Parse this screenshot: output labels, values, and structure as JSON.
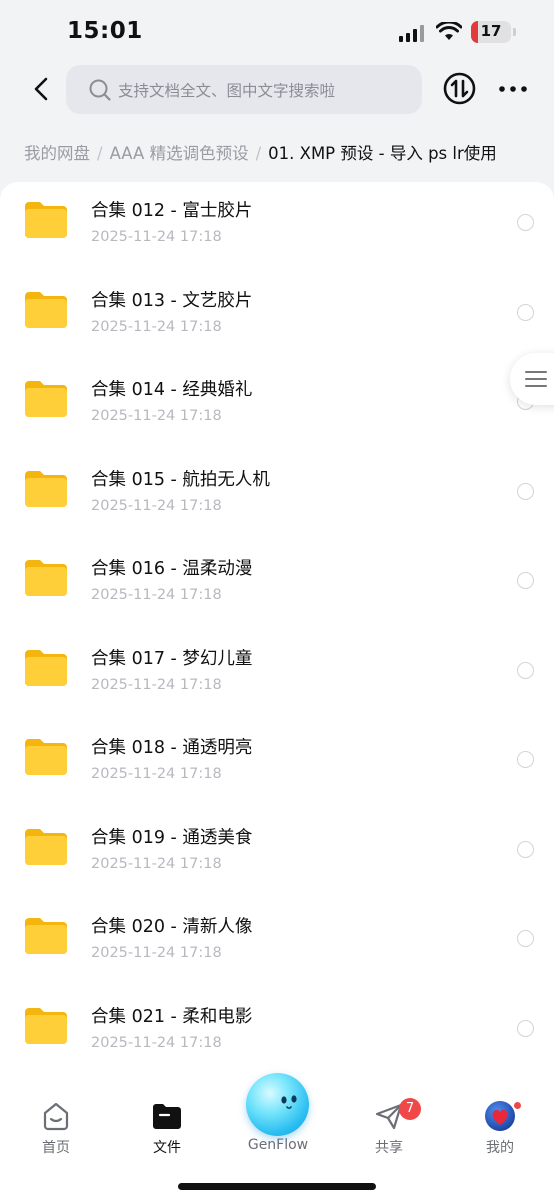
{
  "status_bar": {
    "time": "15:01",
    "battery_level": "17",
    "battery_fraction": 0.17
  },
  "header": {
    "back_icon": "chevron-left-icon",
    "search_placeholder": "支持文档全文、图中文字搜索啦",
    "transfer_icon": "transfer-icon",
    "more_icon": "more-dots-icon"
  },
  "breadcrumb": {
    "items": [
      "我的网盘",
      "AAA 精选调色预设"
    ],
    "separator": "/",
    "current": "01. XMP 预设 - 导入 ps lr使用"
  },
  "files": [
    {
      "name": "合集 012 - 富士胶片",
      "date": "2025-11-24 17:18"
    },
    {
      "name": "合集 013 - 文艺胶片",
      "date": "2025-11-24 17:18"
    },
    {
      "name": "合集 014 - 经典婚礼",
      "date": "2025-11-24 17:18"
    },
    {
      "name": "合集 015 - 航拍无人机",
      "date": "2025-11-24 17:18"
    },
    {
      "name": "合集 016 - 温柔动漫",
      "date": "2025-11-24 17:18"
    },
    {
      "name": "合集 017 - 梦幻儿童",
      "date": "2025-11-24 17:18"
    },
    {
      "name": "合集 018 - 通透明亮",
      "date": "2025-11-24 17:18"
    },
    {
      "name": "合集 019 - 通透美食",
      "date": "2025-11-24 17:18"
    },
    {
      "name": "合集 020 - 清新人像",
      "date": "2025-11-24 17:18"
    },
    {
      "name": "合集 021 - 柔和电影",
      "date": "2025-11-24 17:18"
    }
  ],
  "tab_bar": {
    "tabs": [
      {
        "label": "首页",
        "icon": "home-icon"
      },
      {
        "label": "文件",
        "icon": "folder-icon",
        "active": true
      },
      {
        "label": "GenFlow",
        "icon": "genflow-orb-icon"
      },
      {
        "label": "共享",
        "icon": "send-icon",
        "badge": "7"
      },
      {
        "label": "我的",
        "icon": "avatar-icon"
      }
    ]
  },
  "colors": {
    "folder": "#ffcf3a",
    "badge": "#f04848",
    "genflow": "#29bdf0"
  }
}
